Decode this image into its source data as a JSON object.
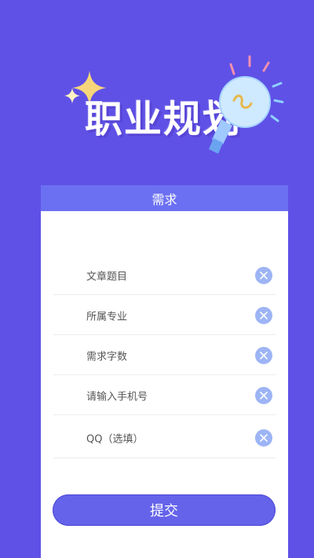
{
  "hero": {
    "title": "职业规划",
    "sparkle_icon": "sparkle-icon",
    "bulb_icon": "lightbulb-icon"
  },
  "card": {
    "header": "需求"
  },
  "form": {
    "fields": [
      {
        "placeholder": "文章题目",
        "clear_icon": "clear-icon"
      },
      {
        "placeholder": "所属专业",
        "clear_icon": "clear-icon"
      },
      {
        "placeholder": "需求字数",
        "clear_icon": "clear-icon"
      },
      {
        "placeholder": "请输入手机号",
        "clear_icon": "clear-icon"
      },
      {
        "placeholder": "QQ（选填）",
        "clear_icon": "clear-icon"
      }
    ],
    "submit_label": "提交"
  },
  "colors": {
    "background": "#5f51e6",
    "card_header": "#6b70f2",
    "submit": "#6463ea",
    "clear_icon": "#9db4f5"
  }
}
